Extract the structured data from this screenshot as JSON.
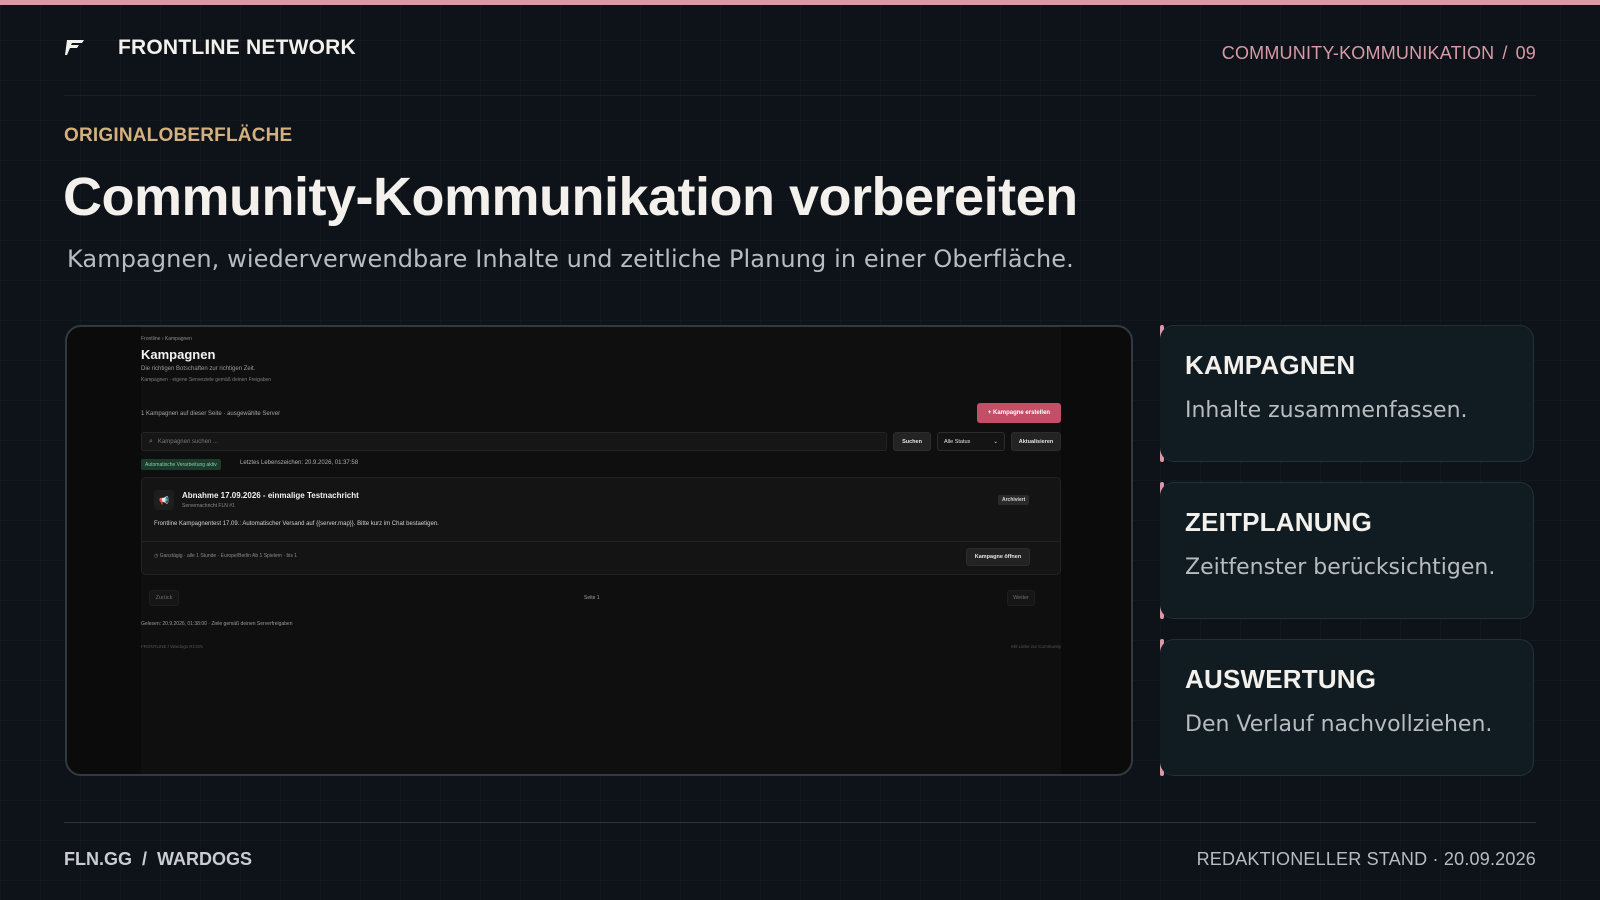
{
  "header": {
    "brand": "FRONTLINE NETWORK",
    "logo_icon": "frontline-logo-icon",
    "section": "COMMUNITY-KOMMUNIKATION",
    "separator": "/",
    "slide_number": "09"
  },
  "hero": {
    "eyebrow": "ORIGINALOBERFLÄCHE",
    "title": "Community-Kommunikation vorbereiten",
    "subtitle": "Kampagnen, wiederverwendbare Inhalte und zeitliche Planung in einer Oberfläche."
  },
  "screenshot": {
    "breadcrumb": "Frontline  ›  Kampagnen",
    "title": "Kampagnen",
    "description": "Die richtigen Botschaften zur richtigen Zeit.",
    "subline": "Kampagnen · eigene Serverziele gemäß deinen Freigaben",
    "count_text": "1 Kampagnen auf dieser Seite · ausgewählte Server",
    "create_button": "+  Kampagne erstellen",
    "search_placeholder": "Kampagnen suchen ...",
    "search_button": "Suchen",
    "status_select": "Alle Status",
    "refresh_button": "Aktualisieren",
    "auto_badge": "Automatische Verarbeitung aktiv",
    "heartbeat": "Letztes Lebenszeichen: 20.9.2026, 01:37:58",
    "campaign": {
      "title": "Abnahme 17.09.2026 - einmalige Testnachricht",
      "meta": "Servernachricht      FLN #1",
      "status": "Archiviert",
      "text": "Frontline Kampagnentest 17.09.: Automatischer Versand auf {{server.map}}. Bitte kurz im Chat bestaetigen.",
      "schedule": "Ganztägig · alle 1 Stunde · Europe/Berlin      Ab 1 Spielern · bis 1",
      "open_button": "Kampagne öffnen"
    },
    "pagination": {
      "prev": "Zurück",
      "page": "Seite 1",
      "next": "Weiter"
    },
    "read_info": "Gelesen: 20.9.2026, 01:38:00 · Ziele gemäß deinen Serverfreigaben",
    "footer_left": "FRONTLINE     /     Wardogs RCON",
    "footer_right": "Mit Liebe zur Community"
  },
  "features": [
    {
      "title": "KAMPAGNEN",
      "text": "Inhalte zusammenfassen."
    },
    {
      "title": "ZEITPLANUNG",
      "text": "Zeitfenster berücksichtigen."
    },
    {
      "title": "AUSWERTUNG",
      "text": "Den Verlauf nachvollziehen."
    }
  ],
  "footer": {
    "site": "FLN.GG",
    "separator": "/",
    "org": "WARDOGS",
    "status": "REDAKTIONELLER STAND · 20.09.2026"
  },
  "colors": {
    "accent_pink": "#d99aa6",
    "accent_gold": "#d4b07e",
    "background": "#0d1319",
    "create_button": "#c34f67"
  }
}
